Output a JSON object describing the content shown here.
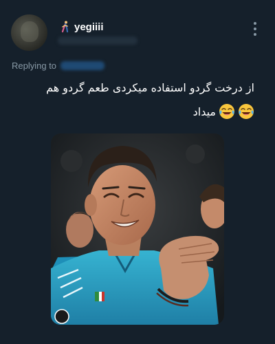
{
  "author": {
    "display_name": "yegiiii",
    "name_emoji_icon": "person-walking-icon"
  },
  "reply": {
    "label": "Replying to"
  },
  "tweet": {
    "text_line_1": "از درخت گردو استفاده میکردی طعم گردو هم",
    "text_line_2": "میداد",
    "emoji_icon": "face-with-tears-of-joy-icon"
  },
  "actions": {
    "more_icon": "more-vertical-icon"
  },
  "colors": {
    "background": "#15202b",
    "text_primary": "#ffffff",
    "text_secondary": "#8899a6",
    "jersey": "#2ea7c7"
  }
}
